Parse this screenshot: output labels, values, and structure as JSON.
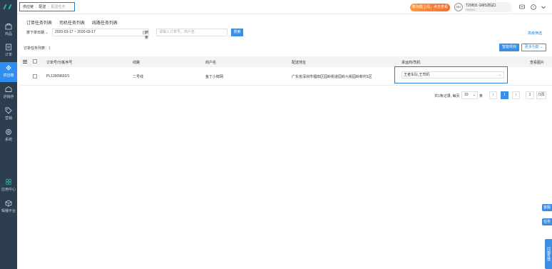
{
  "sidebar": {
    "items": [
      {
        "label": "商品"
      },
      {
        "label": "订单"
      },
      {
        "label": "供应链"
      },
      {
        "label": "进销存"
      },
      {
        "label": "营销"
      },
      {
        "label": "系统"
      },
      {
        "label": "应用中心"
      },
      {
        "label": "辑播平台"
      }
    ]
  },
  "breadcrumb": {
    "items": [
      "供应链",
      "配送",
      "配送任务"
    ]
  },
  "header": {
    "promo": "新功能上线，点击查看",
    "avatar_text": "MV",
    "user_name": "T29831 GMS测试1",
    "user_sub": "GMS01"
  },
  "tabs": [
    "订单任务列表",
    "司机任务列表",
    "线路任务列表"
  ],
  "filters": {
    "date_type": "按下单日期",
    "date_range": "2020-03-17 ~ 2020-03-17",
    "search_label": "搜索",
    "search_placeholder": "请输入订单号，商户名",
    "search_button": "搜索",
    "advanced": "高级筛选"
  },
  "list": {
    "title": "订单任务列表：",
    "count": "1",
    "smart_button": "智能规划",
    "more_button": "更多功能"
  },
  "table": {
    "headers": [
      "订单号/分拣序号",
      "线路",
      "商户名",
      "配送地址",
      "承运商/司机",
      "查看图片"
    ],
    "rows": [
      {
        "order_no": "PL13909692/1",
        "route": "二号线",
        "merchant": "鱼丁小鲜网",
        "address": "广东省深圳市福田区园岭街道园岭九街园岭新村1区",
        "carrier": "王者车队,王司机"
      }
    ]
  },
  "pagination": {
    "total_text": "共1条记录, 每页",
    "page_size": "10",
    "unit": "条",
    "current_page": "1",
    "jump_value": "1",
    "jump_label": "/1页"
  },
  "floating": {
    "service": "客服",
    "task": "任务",
    "feedback": "问题反馈"
  }
}
